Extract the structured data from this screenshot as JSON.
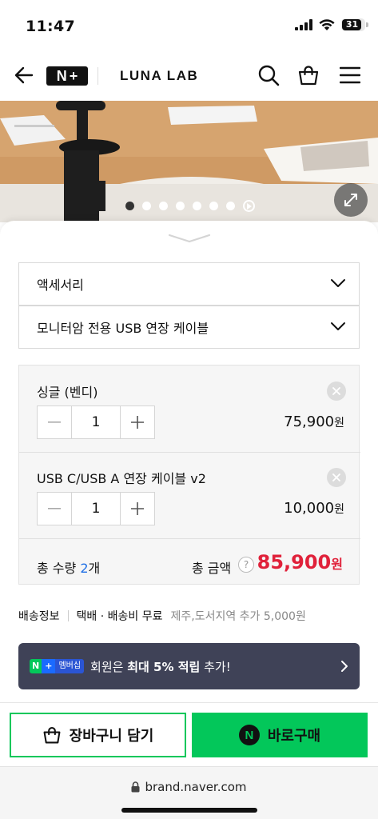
{
  "status": {
    "time": "11:47",
    "battery": "31"
  },
  "header": {
    "logo_n": "N",
    "logo_plus": "+",
    "brand": "LUNA LAB",
    "icons": [
      "back-arrow-icon",
      "search-icon",
      "shopping-bag-icon",
      "menu-icon"
    ]
  },
  "gallery": {
    "slide_count": 7,
    "active_index": 0
  },
  "options": {
    "category_select": "액세서리",
    "product_select": "모니터암 전용 USB 연장 케이블"
  },
  "selected_items": [
    {
      "name": "싱글 (벤디)",
      "quantity": "1",
      "price": "75,900",
      "unit": "원"
    },
    {
      "name": "USB C/USB A 연장 케이블 v2",
      "quantity": "1",
      "price": "10,000",
      "unit": "원"
    }
  ],
  "totals": {
    "qty_label": "총 수량",
    "qty_value": "2",
    "qty_unit": "개",
    "amount_label": "총 금액",
    "help": "?",
    "amount_value": "85,900",
    "amount_unit": "원"
  },
  "shipping": {
    "label": "배송정보",
    "method": "택배 · 배송비 무료",
    "extra": "제주,도서지역 추가 5,000원"
  },
  "promo": {
    "badge_n": "N",
    "badge_plus": "+",
    "badge_text": "멤버십",
    "text_pre": "회원은 ",
    "text_bold": "최대 5% 적립",
    "text_post": " 추가!"
  },
  "actions": {
    "cart_label": "장바구니 담기",
    "buy_icon": "N",
    "buy_label": "바로구매"
  },
  "browser": {
    "url": "brand.naver.com"
  },
  "colors": {
    "naver_green": "#03c75a",
    "price_red": "#e0213a",
    "qty_blue": "#1f6fe5",
    "promo_bg": "#3f4257"
  }
}
